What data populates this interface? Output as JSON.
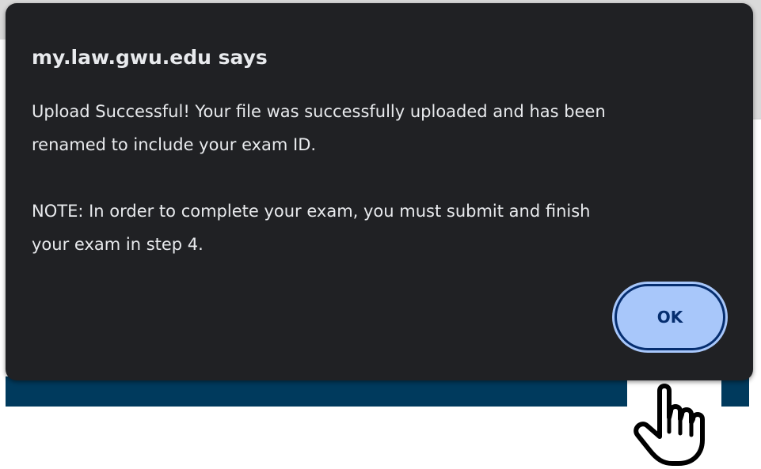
{
  "dialog": {
    "title": "my.law.gwu.edu says",
    "message": "Upload Successful! Your file was successfully uploaded and has been\nrenamed to include your exam ID.\n\nNOTE: In order to complete your exam, you must submit and finish\nyour exam in step 4.",
    "ok_label": "OK"
  },
  "cursor": {
    "icon": "pointing-hand-icon"
  },
  "colors": {
    "dialog_background": "#202124",
    "text": "#e8eaed",
    "button_fill": "#a8c7fa",
    "button_text": "#062e6f",
    "page_navy": "#003a5d"
  }
}
